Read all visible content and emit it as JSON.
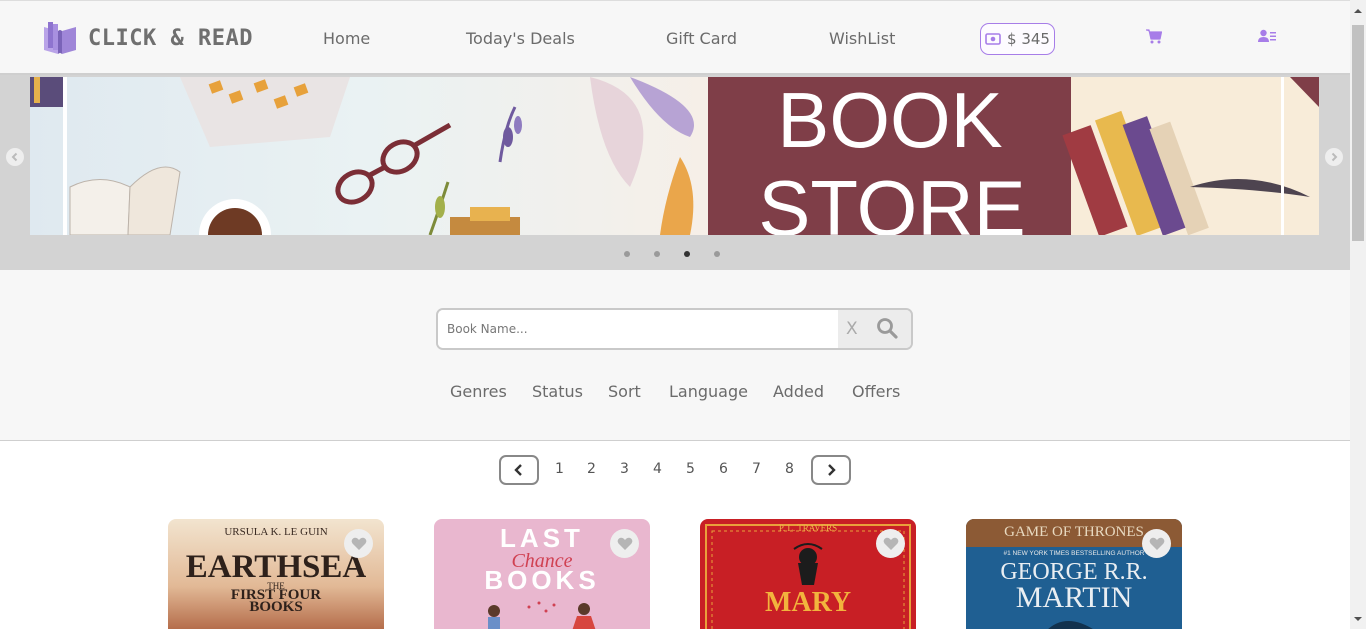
{
  "header": {
    "logo_text": "CLICK & READ",
    "nav": [
      "Home",
      "Today's Deals",
      "Gift Card",
      "WishList"
    ],
    "balance": "$ 345",
    "accent_color": "#a77de8"
  },
  "banner": {
    "title_line1": "BOOK",
    "title_line2": "STORE",
    "slide_count": 4,
    "active_slide": 3
  },
  "search": {
    "placeholder": "Book Name...",
    "clear_label": "X"
  },
  "filters": [
    "Genres",
    "Status",
    "Sort",
    "Language",
    "Added",
    "Offers"
  ],
  "pagination": {
    "pages": [
      "1",
      "2",
      "3",
      "4",
      "5",
      "6",
      "7",
      "8"
    ]
  },
  "books": [
    {
      "author": "URSULA K. LE GUIN",
      "title_1": "EARTHSEA",
      "title_2": "THE",
      "title_3": "FIRST FOUR",
      "title_4": "BOOKS"
    },
    {
      "title_1": "LAST",
      "title_2": "Chance",
      "title_3": "BOOKS"
    },
    {
      "author": "P. L. TRAVERS",
      "title_1": "MARY"
    },
    {
      "series": "GAME OF THRONES",
      "tagline": "#1 NEW YORK TIMES BESTSELLING AUTHOR",
      "author_1": "GEORGE R.R.",
      "author_2": "MARTIN"
    }
  ]
}
